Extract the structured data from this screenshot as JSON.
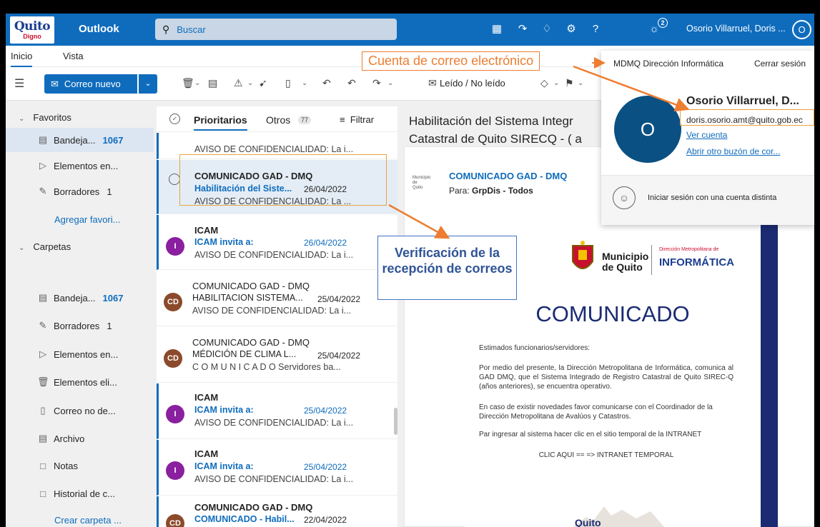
{
  "topbar": {
    "logo_text": "Quito",
    "logo_sub": "Digno",
    "app_name": "Outlook",
    "search_placeholder": "Buscar",
    "badge_count": "2",
    "user_name": "Osorio Villarruel, Doris ...",
    "avatar_initial": "O",
    "icons": [
      "apps-icon",
      "flag-arrow-icon",
      "bell-icon",
      "gear-icon",
      "help-icon",
      "lightbulb-icon"
    ]
  },
  "tabs": {
    "inicio": "Inicio",
    "vista": "Vista"
  },
  "ribbon": {
    "new_mail": "Correo nuevo",
    "read_unread": "Leído / No leído"
  },
  "sidebar": {
    "favorites_label": "Favoritos",
    "favorites": [
      {
        "label": "Bandeja...",
        "count": "1067",
        "icon": "inbox-icon"
      },
      {
        "label": "Elementos en...",
        "count": "",
        "icon": "send-icon"
      },
      {
        "label": "Borradores",
        "count": "1",
        "icon": "draft-icon"
      }
    ],
    "add_favorite": "Agregar favori...",
    "folders_label": "Carpetas",
    "folders": [
      {
        "label": "Bandeja...",
        "count": "1067",
        "icon": "inbox-icon"
      },
      {
        "label": "Borradores",
        "count": "1",
        "icon": "draft-icon"
      },
      {
        "label": "Elementos en...",
        "count": "",
        "icon": "send-icon"
      },
      {
        "label": "Elementos eli...",
        "count": "",
        "icon": "trash-icon"
      },
      {
        "label": "Correo no de...",
        "count": "",
        "icon": "junk-icon"
      },
      {
        "label": "Archivo",
        "count": "",
        "icon": "archive-icon"
      },
      {
        "label": "Notas",
        "count": "",
        "icon": "note-icon"
      },
      {
        "label": "Historial de c...",
        "count": "",
        "icon": "folder-icon"
      }
    ],
    "create_folder": "Crear carpeta ..."
  },
  "list": {
    "focused": "Prioritarios",
    "other": "Otros",
    "other_count": "77",
    "filter": "Filtrar",
    "top_preview": "AVISO DE CONFIDENCIALIDAD: La i...",
    "messages": [
      {
        "from": "COMUNICADO GAD - DMQ",
        "subject": "Habilitación del Siste...",
        "date": "26/04/2022",
        "preview": "AVISO DE CONFIDENCIALIDAD: La ..."
      },
      {
        "from": "ICAM",
        "subject": "ICAM invita a:",
        "date": "26/04/2022",
        "preview": "AVISO DE CONFIDENCIALIDAD: La i...",
        "avatar": "I"
      },
      {
        "from": "COMUNICADO GAD - DMQ",
        "subject": "HABILITACION SISTEMA...",
        "date": "25/04/2022",
        "preview": "AVISO DE CONFIDENCIALIDAD: La i...",
        "avatar": "CD"
      },
      {
        "from": "COMUNICADO GAD - DMQ",
        "subject": "MÉDICIÓN DE CLIMA L...",
        "date": "25/04/2022",
        "preview": "C O M U N I C A D O Servidores ba...",
        "avatar": "CD"
      },
      {
        "from": "ICAM",
        "subject": "ICAM invita a:",
        "date": "25/04/2022",
        "preview": "AVISO DE CONFIDENCIALIDAD: La i...",
        "avatar": "I"
      },
      {
        "from": "ICAM",
        "subject": "ICAM invita a:",
        "date": "25/04/2022",
        "preview": "AVISO DE CONFIDENCIALIDAD: La i...",
        "avatar": "I"
      },
      {
        "from": "COMUNICADO GAD - DMQ",
        "subject": "COMUNICADO - Habil...",
        "date": "22/04/2022",
        "preview": "",
        "avatar": "CD"
      }
    ]
  },
  "reading": {
    "title": "Habilitación del Sistema Integr Catastral de Quito SIRECQ - ( a",
    "from": "COMUNICADO GAD - DMQ",
    "to_label": "Para:",
    "to_value": "GrpDis - Todos",
    "doc": {
      "logo_mini": "Municipio de Quito",
      "municipio": "Municipio de Quito",
      "direccion": "Dirección Metropolitana de",
      "informatica": "INFORMÁTICA",
      "title": "COMUNICADO",
      "greeting": "Estimados funcionarios/servidores:",
      "p1": "Por medio del presente, la Dirección Metropolitana de Informática, comunica al GAD DMQ, que el Sistema Integrado de Registro Catastral de Quito SIREC-Q (años anteriores), se encuentra operativo.",
      "p2": "En caso de existir novedades favor comunicarse con el Coordinador de la Dirección Metropolitana de Avalúos y Catastros.",
      "p3": "Par ingresar al sistema hacer clic en el sitio temporal de la INTRANET",
      "p4": "CLIC AQUI == => INTRANET TEMPORAL",
      "footer_logo": "Quito"
    }
  },
  "account_panel": {
    "org": "MDMQ Dirección Informática",
    "sign_out": "Cerrar sesión",
    "avatar": "O",
    "name": "Osorio Villarruel, D...",
    "email": "doris.osorio.amt@quito.gob.ec",
    "view_account": "Ver cuenta",
    "open_other": "Abrir otro buzón de cor...",
    "other_account": "Iniciar sesión con una cuenta distinta"
  },
  "annotations": {
    "email_account": "Cuenta de correo electrónico",
    "verification": "Verificación de la recepción de correos"
  },
  "colors": {
    "brand": "#0f6cbd",
    "accent_orange": "#ed7d31",
    "avatar_ca": "#8b4a2b",
    "avatar_i": "#8a1f9f"
  }
}
